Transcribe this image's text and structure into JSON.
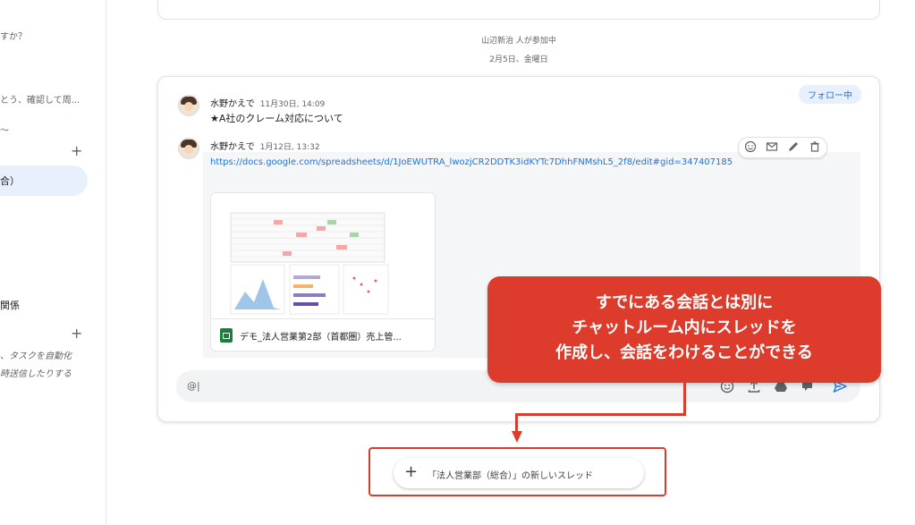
{
  "sidebar": {
    "snippet_top": "すか？",
    "snippet_2": "とう、確認して周...",
    "snippet_3": "〜",
    "active_item": "合）",
    "section_label": "関係",
    "desc_line1": "、タスクを自動化",
    "desc_line2": "時送信したりする",
    "plus": "+"
  },
  "system": {
    "joined": "山辺新治 人が参加中",
    "date": "2月5日、金曜日"
  },
  "thread": {
    "follow_label": "フォロー中",
    "message1": {
      "author": "水野かえで",
      "time": "11月30日, 14:09",
      "text": "★A社のクレーム対応について"
    },
    "message2": {
      "author": "水野かえで",
      "time": "1月12日, 13:32",
      "link": "https://docs.google.com/spreadsheets/d/1JoEWUTRA_lwozjCR2DDTK3idKYTc7DhhFNMshL5_2f8/edit#gid=347407185",
      "attachment_title": "デモ_法人営業第2部（首都圏）売上管..."
    },
    "hover_actions": [
      "smile-icon",
      "mail-icon",
      "edit-icon",
      "delete-icon"
    ],
    "composer_placeholder": "@|"
  },
  "callout": {
    "line1": "すでにある会話とは別に",
    "line2": "チャットルーム内にスレッドを",
    "line3": "作成し、会話をわけることができる"
  },
  "new_thread": {
    "plus": "+",
    "label": "「法人営業部（総合）」の新しいスレッド"
  },
  "colors": {
    "accent": "#1a73e8",
    "callout": "#dd3b2b",
    "follow_bg": "#e8f0fe",
    "sheets_green": "#188038"
  }
}
